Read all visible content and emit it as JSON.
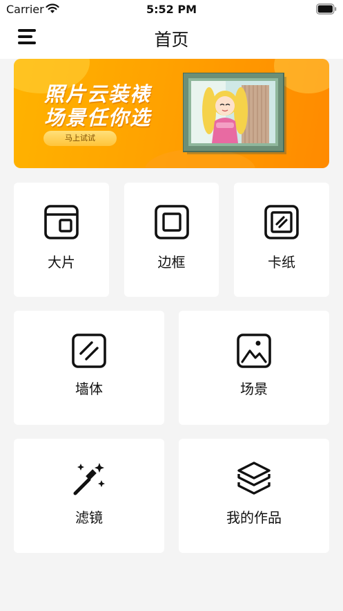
{
  "status_bar": {
    "carrier": "Carrier",
    "time": "5:52 PM"
  },
  "nav": {
    "title": "首页",
    "menu_icon": "menu-icon"
  },
  "banner": {
    "line1": "照片云装裱",
    "line2": "场景任你选",
    "button_label": "马上试试",
    "accent_color": "#ffa200"
  },
  "tiles": [
    {
      "label": "大片",
      "icon": "photo-card-icon"
    },
    {
      "label": "边框",
      "icon": "frame-icon"
    },
    {
      "label": "卡纸",
      "icon": "mat-board-icon"
    },
    {
      "label": "墙体",
      "icon": "wall-icon"
    },
    {
      "label": "场景",
      "icon": "scene-image-icon"
    },
    {
      "label": "滤镜",
      "icon": "magic-wand-icon"
    },
    {
      "label": "我的作品",
      "icon": "layers-icon"
    }
  ]
}
